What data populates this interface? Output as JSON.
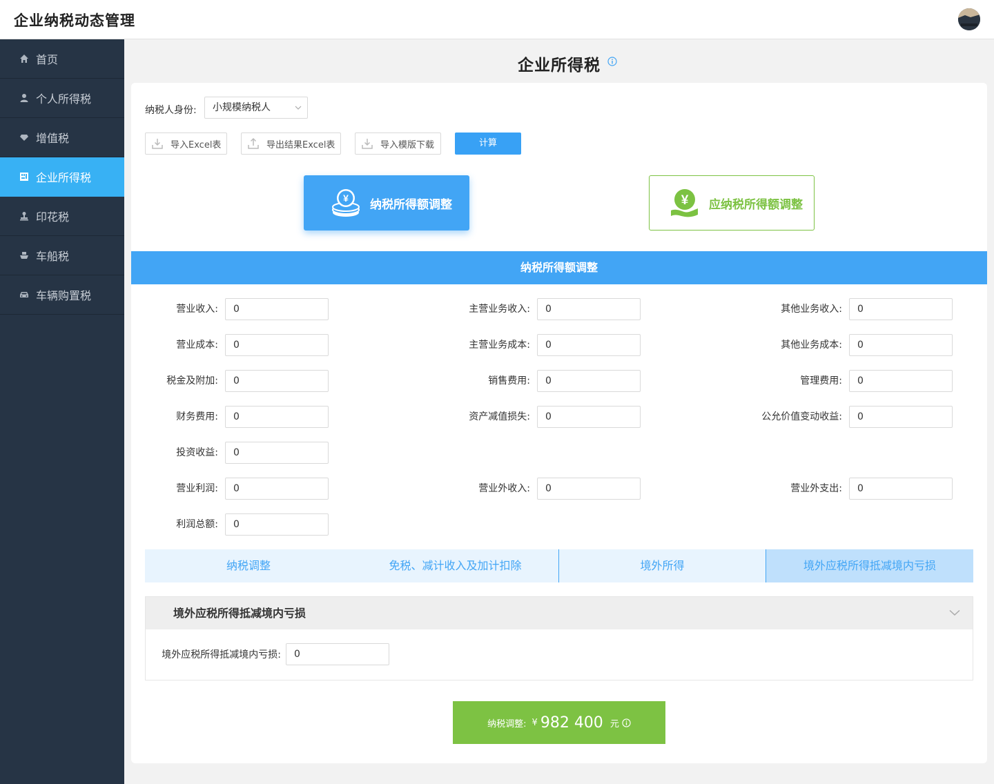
{
  "header": {
    "title": "企业纳税动态管理"
  },
  "sidebar": {
    "items": [
      {
        "label": "首页",
        "icon": "home-icon"
      },
      {
        "label": "个人所得税",
        "icon": "user-icon"
      },
      {
        "label": "增值税",
        "icon": "diamond-icon"
      },
      {
        "label": "企业所得税",
        "icon": "building-icon",
        "active": true
      },
      {
        "label": "印花税",
        "icon": "stamp-icon"
      },
      {
        "label": "车船税",
        "icon": "ship-icon"
      },
      {
        "label": "车辆购置税",
        "icon": "car-icon"
      }
    ]
  },
  "page": {
    "title": "企业所得税"
  },
  "filters": {
    "identity_label": "纳税人身份:",
    "identity_value": "小规模纳税人"
  },
  "toolbar": {
    "import_excel": "导入Excel表",
    "export_excel": "导出结果Excel表",
    "template_download": "导入模版下载",
    "calculate": "计算"
  },
  "mode_cards": {
    "taxable_income": "纳税所得额调整",
    "payable_income": "应纳税所得额调整"
  },
  "section": {
    "title": "纳税所得额调整"
  },
  "fields": {
    "revenue": {
      "label": "营业收入:",
      "value": "0"
    },
    "main_revenue": {
      "label": "主营业务收入:",
      "value": "0"
    },
    "other_revenue": {
      "label": "其他业务收入:",
      "value": "0"
    },
    "cost": {
      "label": "营业成本:",
      "value": "0"
    },
    "main_cost": {
      "label": "主营业务成本:",
      "value": "0"
    },
    "other_cost": {
      "label": "其他业务成本:",
      "value": "0"
    },
    "taxes": {
      "label": "税金及附加:",
      "value": "0"
    },
    "selling": {
      "label": "销售费用:",
      "value": "0"
    },
    "admin": {
      "label": "管理费用:",
      "value": "0"
    },
    "finance": {
      "label": "财务费用:",
      "value": "0"
    },
    "impairment": {
      "label": "资产减值损失:",
      "value": "0"
    },
    "fair_value": {
      "label": "公允价值变动收益:",
      "value": "0"
    },
    "investment": {
      "label": "投资收益:",
      "value": "0"
    },
    "op_profit": {
      "label": "营业利润:",
      "value": "0"
    },
    "non_op_income": {
      "label": "营业外收入:",
      "value": "0"
    },
    "non_op_expense": {
      "label": "营业外支出:",
      "value": "0"
    },
    "total_profit": {
      "label": "利润总额:",
      "value": "0"
    }
  },
  "tabs": [
    {
      "label": "纳税调整"
    },
    {
      "label": "免税、减计收入及加计扣除"
    },
    {
      "label": "境外所得"
    },
    {
      "label": "境外应税所得抵减境内亏损",
      "selected": true
    }
  ],
  "panel": {
    "title": "境外应税所得抵减境内亏损",
    "field_label": "境外应税所得抵减境内亏损:",
    "field_value": "0"
  },
  "result": {
    "label": "纳税调整:",
    "currency": "¥",
    "value": "982 400",
    "unit": "元"
  },
  "colors": {
    "primary": "#42a5f5",
    "sidebar": "#263445",
    "active": "#38b1f4",
    "success": "#7dc243"
  }
}
